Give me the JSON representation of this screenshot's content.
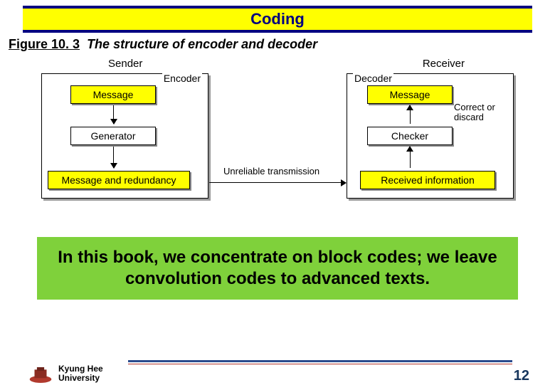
{
  "title": "Coding",
  "figure": {
    "number": "Figure 10. 3",
    "caption": "The structure of encoder and decoder"
  },
  "diagram": {
    "sender_label": "Sender",
    "receiver_label": "Receiver",
    "encoder_title": "Encoder",
    "decoder_title": "Decoder",
    "encoder": {
      "message": "Message",
      "generator": "Generator",
      "out": "Message and redundancy"
    },
    "decoder": {
      "message": "Message",
      "checker": "Checker",
      "in": "Received information",
      "note": "Correct or discard"
    },
    "transmission": "Unreliable transmission"
  },
  "note": "In this book, we concentrate on block codes; we leave convolution codes to advanced texts.",
  "footer": {
    "university_line1": "Kyung Hee",
    "university_line2": "University",
    "page": "12"
  }
}
